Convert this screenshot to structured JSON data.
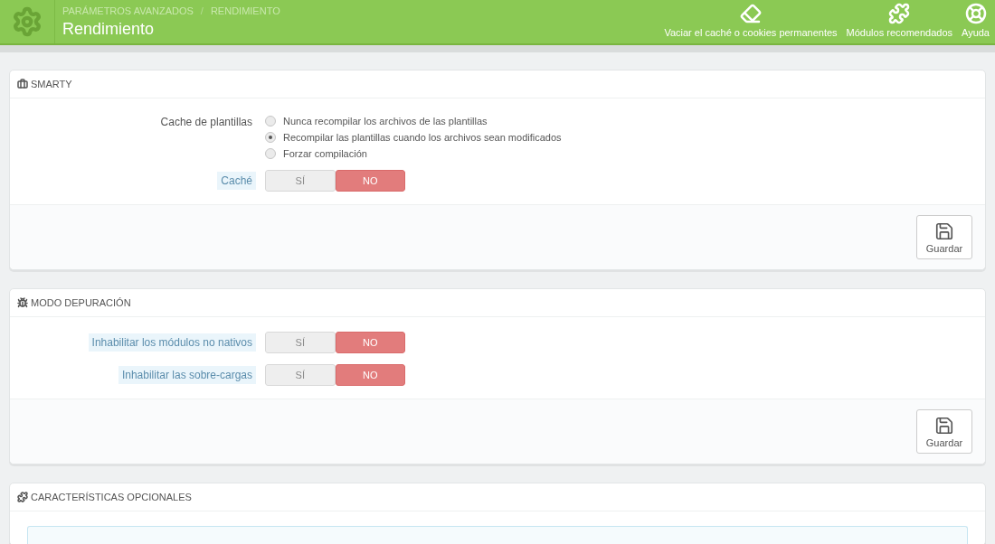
{
  "header": {
    "breadcrumb": [
      "PARÁMETROS AVANZADOS",
      "RENDIMIENTO"
    ],
    "separator": "/",
    "title": "Rendimiento",
    "toolbar": [
      {
        "kind": "eraser",
        "label": "Vaciar el caché o cookies permanentes"
      },
      {
        "kind": "puzzle",
        "label": "Módulos recomendados"
      },
      {
        "kind": "lifebuoy",
        "label": "Ayuda"
      }
    ]
  },
  "panels": [
    {
      "kind": "briefcase",
      "title": "SMARTY",
      "save_button": "Guardar",
      "fields": [
        {
          "kind": "radio",
          "label": "Cache de plantillas",
          "hint": false,
          "options": [
            {
              "label": "Nunca recompilar los archivos de las plantillas",
              "selected": false
            },
            {
              "label": "Recompilar las plantillas cuando los archivos sean modificados",
              "selected": true
            },
            {
              "label": "Forzar compilación",
              "selected": false
            }
          ]
        },
        {
          "kind": "switch",
          "label": "Caché",
          "hint": true,
          "options": [
            {
              "label": "SÍ",
              "selected": false
            },
            {
              "label": "NO",
              "selected": true
            }
          ]
        }
      ]
    },
    {
      "kind": "bug",
      "title": "MODO DEPURACIÓN",
      "save_button": "Guardar",
      "fields": [
        {
          "kind": "switch",
          "label": "Inhabilitar los módulos no nativos",
          "hint": true,
          "options": [
            {
              "label": "SÍ",
              "selected": false
            },
            {
              "label": "NO",
              "selected": true
            }
          ]
        },
        {
          "kind": "switch",
          "label": "Inhabilitar las sobre-cargas",
          "hint": true,
          "options": [
            {
              "label": "SÍ",
              "selected": false
            },
            {
              "label": "NO",
              "selected": true
            }
          ]
        }
      ]
    },
    {
      "kind": "puzzle",
      "title": "CARACTERÍSTICAS OPCIONALES",
      "info_box": true
    }
  ]
}
